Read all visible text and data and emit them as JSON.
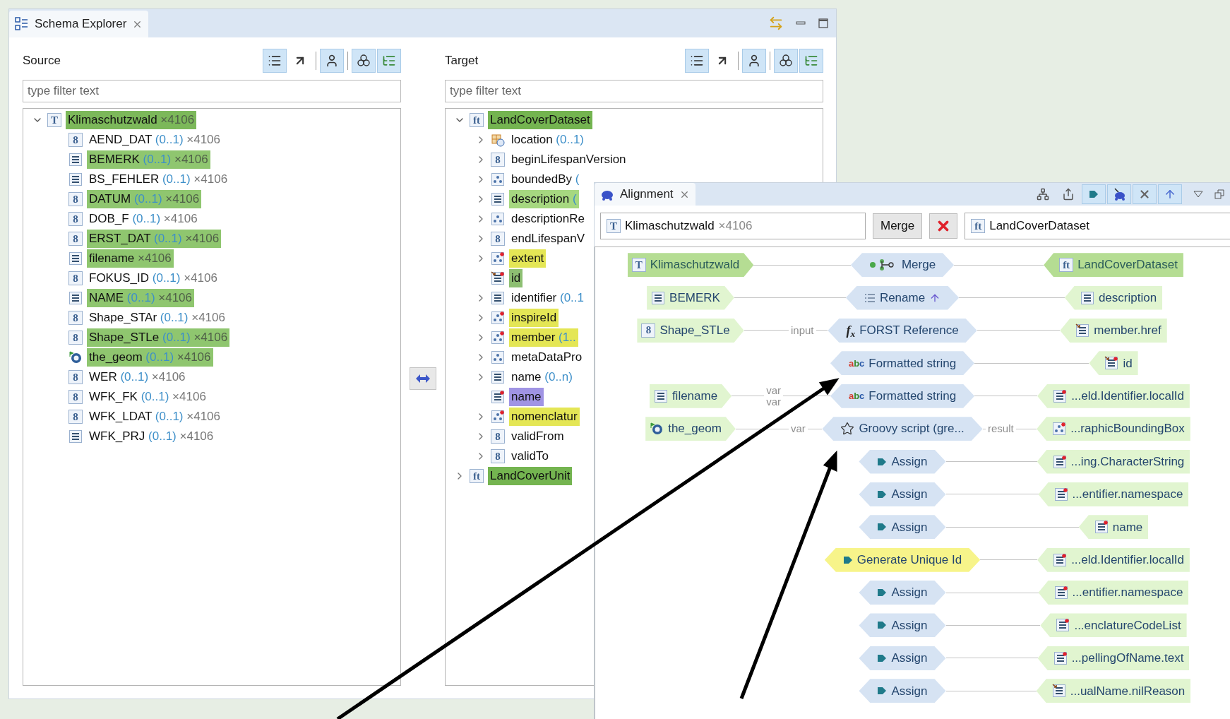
{
  "explorer": {
    "tab": {
      "title": "Schema Explorer"
    },
    "panels": [
      {
        "title": "Source",
        "tools": [
          {
            "kind": "list",
            "selected": true
          },
          {
            "kind": "goto",
            "selected": false
          },
          {
            "kind": "type",
            "selected": true
          },
          {
            "kind": "group",
            "selected": true
          },
          {
            "kind": "tree",
            "selected": true
          }
        ],
        "filter": {
          "placeholder": "type filter text"
        },
        "tree": [
          {
            "label": "Klimaschutzwald",
            "icon": {
              "kind": "letter",
              "text": "T"
            },
            "count": "×4106",
            "color": "#7cb85a",
            "expanded": true,
            "children": [
              {
                "label": "AEND_DAT",
                "cardinality": "(0..1)",
                "count": "×4106",
                "icon": {
                  "kind": "letter",
                  "text": "8"
                }
              },
              {
                "label": "BEMERK",
                "cardinality": "(0..1)",
                "count": "×4106",
                "icon": {
                  "kind": "string"
                },
                "color": "#8fc66f"
              },
              {
                "label": "BS_FEHLER",
                "cardinality": "(0..1)",
                "count": "×4106",
                "icon": {
                  "kind": "string"
                }
              },
              {
                "label": "DATUM",
                "cardinality": "(0..1)",
                "count": "×4106",
                "icon": {
                  "kind": "letter",
                  "text": "8"
                },
                "color": "#8fc66f"
              },
              {
                "label": "DOB_F",
                "cardinality": "(0..1)",
                "count": "×4106",
                "icon": {
                  "kind": "letter",
                  "text": "8"
                }
              },
              {
                "label": "ERST_DAT",
                "cardinality": "(0..1)",
                "count": "×4106",
                "icon": {
                  "kind": "letter",
                  "text": "8"
                },
                "color": "#8fc66f"
              },
              {
                "label": "filename",
                "count": "×4106",
                "icon": {
                  "kind": "string"
                },
                "color": "#8fc66f"
              },
              {
                "label": "FOKUS_ID",
                "cardinality": "(0..1)",
                "count": "×4106",
                "icon": {
                  "kind": "letter",
                  "text": "8"
                }
              },
              {
                "label": "NAME",
                "cardinality": "(0..1)",
                "count": "×4106",
                "icon": {
                  "kind": "string"
                },
                "color": "#8fc66f"
              },
              {
                "label": "Shape_STAr",
                "cardinality": "(0..1)",
                "count": "×4106",
                "icon": {
                  "kind": "letter",
                  "text": "8"
                }
              },
              {
                "label": "Shape_STLe",
                "cardinality": "(0..1)",
                "count": "×4106",
                "icon": {
                  "kind": "letter",
                  "text": "8"
                },
                "color": "#8fc66f"
              },
              {
                "label": "the_geom",
                "cardinality": "(0..1)",
                "count": "×4106",
                "icon": {
                  "kind": "geometry"
                },
                "color": "#8fc66f"
              },
              {
                "label": "WER",
                "cardinality": "(0..1)",
                "count": "×4106",
                "icon": {
                  "kind": "letter",
                  "text": "8"
                }
              },
              {
                "label": "WFK_FK",
                "cardinality": "(0..1)",
                "count": "×4106",
                "icon": {
                  "kind": "letter",
                  "text": "8"
                }
              },
              {
                "label": "WFK_LDAT",
                "cardinality": "(0..1)",
                "count": "×4106",
                "icon": {
                  "kind": "letter",
                  "text": "8"
                }
              },
              {
                "label": "WFK_PRJ",
                "cardinality": "(0..1)",
                "count": "×4106",
                "icon": {
                  "kind": "string"
                }
              }
            ]
          }
        ]
      },
      {
        "title": "Target",
        "tools": [
          {
            "kind": "list",
            "selected": true
          },
          {
            "kind": "goto",
            "selected": false
          },
          {
            "kind": "type",
            "selected": true
          },
          {
            "kind": "group",
            "selected": true
          },
          {
            "kind": "tree",
            "selected": true
          }
        ],
        "filter": {
          "placeholder": "type filter text"
        },
        "tree": [
          {
            "label": "LandCoverDataset",
            "icon": {
              "kind": "letter",
              "text": "ft"
            },
            "color": "#74b450",
            "expanded": true,
            "children": [
              {
                "label": "location",
                "cardinality": "(0..1)",
                "icon": {
                  "kind": "location"
                },
                "expanded": false
              },
              {
                "label": "beginLifespanVersion",
                "icon": {
                  "kind": "letter",
                  "text": "8"
                },
                "expanded": false
              },
              {
                "label": "boundedBy",
                "cardinality": "(",
                "icon": {
                  "kind": "group"
                },
                "expanded": false
              },
              {
                "label": "description",
                "cardinality": "(",
                "icon": {
                  "kind": "string"
                },
                "color": "#a6d880",
                "expanded": false
              },
              {
                "label": "descriptionRe",
                "icon": {
                  "kind": "group"
                },
                "expanded": false
              },
              {
                "label": "endLifespanV",
                "icon": {
                  "kind": "letter",
                  "text": "8"
                },
                "expanded": false
              },
              {
                "label": "extent",
                "icon": {
                  "kind": "group-required"
                },
                "color": "#e4e655",
                "expanded": false
              },
              {
                "label": "id",
                "icon": {
                  "kind": "reference-required"
                },
                "color": "#8dbf72"
              },
              {
                "label": "identifier",
                "cardinality": "(0..1",
                "icon": {
                  "kind": "string"
                },
                "expanded": false
              },
              {
                "label": "inspireId",
                "icon": {
                  "kind": "group-required"
                },
                "color": "#e4e655",
                "expanded": false
              },
              {
                "label": "member",
                "cardinality": "(1..",
                "icon": {
                  "kind": "group-required"
                },
                "color": "#e4e655",
                "expanded": false
              },
              {
                "label": "metaDataPro",
                "icon": {
                  "kind": "group"
                },
                "expanded": false
              },
              {
                "label": "name",
                "cardinality": "(0..n)",
                "icon": {
                  "kind": "string"
                },
                "expanded": false
              },
              {
                "label": "name",
                "icon": {
                  "kind": "string-required"
                },
                "color": "#a094e4"
              },
              {
                "label": "nomenclatur",
                "icon": {
                  "kind": "group-required"
                },
                "color": "#e4e655",
                "expanded": false
              },
              {
                "label": "validFrom",
                "icon": {
                  "kind": "letter",
                  "text": "8"
                },
                "expanded": false
              },
              {
                "label": "validTo",
                "icon": {
                  "kind": "letter",
                  "text": "8"
                },
                "expanded": false
              }
            ]
          },
          {
            "label": "LandCoverUnit",
            "icon": {
              "kind": "letter",
              "text": "ft"
            },
            "color": "#74b450",
            "expanded": false
          }
        ]
      }
    ]
  },
  "alignment": {
    "tab": {
      "title": "Alignment"
    },
    "tools": [
      {
        "kind": "hierarchy",
        "selected": false
      },
      {
        "kind": "export",
        "selected": false
      },
      {
        "kind": "play",
        "selected": true
      },
      {
        "kind": "figure",
        "selected": true
      },
      {
        "kind": "cross",
        "selected": true
      },
      {
        "kind": "up",
        "selected": true
      }
    ],
    "source_field": {
      "icon": {
        "kind": "letter",
        "text": "T"
      },
      "value": "Klimaschutzwald",
      "count": "×4106"
    },
    "merge_button": "Merge",
    "target_field": {
      "icon": {
        "kind": "letter",
        "text": "ft"
      },
      "value": "LandCoverDataset"
    },
    "cells": [
      {
        "source": {
          "label": "Klimaschutzwald",
          "icon": {
            "kind": "letter",
            "text": "T"
          },
          "kind": "type"
        },
        "function": {
          "label": "Merge",
          "icon": {
            "kind": "merge"
          },
          "highlighted": false
        },
        "target": {
          "label": "LandCoverDataset",
          "icon": {
            "kind": "letter",
            "text": "ft"
          },
          "kind": "type"
        }
      },
      {
        "source": {
          "label": "BEMERK",
          "icon": {
            "kind": "string"
          },
          "kind": "property"
        },
        "function": {
          "label": "Rename",
          "icon": {
            "kind": "rename"
          },
          "up_arrow": true,
          "highlighted": false
        },
        "target": {
          "label": "description",
          "icon": {
            "kind": "string"
          },
          "kind": "property"
        }
      },
      {
        "source": {
          "label": "Shape_STLe",
          "icon": {
            "kind": "letter",
            "text": "8"
          },
          "kind": "property"
        },
        "source_links": [
          "input"
        ],
        "function": {
          "label": "FORST Reference",
          "icon": {
            "kind": "text",
            "text": "f$_{x}$"
          },
          "highlighted": false
        },
        "target": {
          "label": "member.href",
          "icon": {
            "kind": "reference"
          },
          "kind": "property"
        }
      },
      {
        "function": {
          "label": "Formatted string",
          "icon": {
            "kind": "abc",
            "text": "abc"
          },
          "highlighted": false
        },
        "target": {
          "label": "id",
          "icon": {
            "kind": "reference-required"
          },
          "kind": "property"
        }
      },
      {
        "source": {
          "label": "filename",
          "icon": {
            "kind": "string"
          },
          "kind": "property"
        },
        "source_links": [
          "var",
          "var"
        ],
        "function": {
          "label": "Formatted string",
          "icon": {
            "kind": "abc",
            "text": "abc"
          },
          "highlighted": false
        },
        "target": {
          "label": "...eld.Identifier.localId",
          "icon": {
            "kind": "string-required"
          },
          "kind": "property"
        }
      },
      {
        "source": {
          "label": "the_geom",
          "icon": {
            "kind": "geometry"
          },
          "kind": "property"
        },
        "source_links": [
          "var"
        ],
        "function": {
          "label": "Groovy script (gre...",
          "icon": {
            "kind": "star"
          },
          "highlighted": false
        },
        "target_links": [
          "result"
        ],
        "target": {
          "label": "...raphicBoundingBox",
          "icon": {
            "kind": "group-required"
          },
          "kind": "property"
        }
      },
      {
        "function": {
          "label": "Assign",
          "icon": {
            "kind": "assign"
          },
          "highlighted": false
        },
        "target": {
          "label": "...ing.CharacterString",
          "icon": {
            "kind": "string-required"
          },
          "kind": "property"
        }
      },
      {
        "function": {
          "label": "Assign",
          "icon": {
            "kind": "assign"
          },
          "highlighted": false
        },
        "target": {
          "label": "...entifier.namespace",
          "icon": {
            "kind": "string-required"
          },
          "kind": "property"
        }
      },
      {
        "function": {
          "label": "Assign",
          "icon": {
            "kind": "assign"
          },
          "highlighted": false
        },
        "target": {
          "label": "name",
          "icon": {
            "kind": "string-required"
          },
          "kind": "property"
        }
      },
      {
        "function": {
          "label": "Generate Unique Id",
          "icon": {
            "kind": "assign"
          },
          "highlighted": true
        },
        "target": {
          "label": "...eld.Identifier.localId",
          "icon": {
            "kind": "string-required"
          },
          "kind": "property"
        }
      },
      {
        "function": {
          "label": "Assign",
          "icon": {
            "kind": "assign"
          },
          "highlighted": false
        },
        "target": {
          "label": "...entifier.namespace",
          "icon": {
            "kind": "string-required"
          },
          "kind": "property"
        }
      },
      {
        "function": {
          "label": "Assign",
          "icon": {
            "kind": "assign"
          },
          "highlighted": false
        },
        "target": {
          "label": "...enclatureCodeList",
          "icon": {
            "kind": "string-required"
          },
          "kind": "property"
        }
      },
      {
        "function": {
          "label": "Assign",
          "icon": {
            "kind": "assign"
          },
          "highlighted": false
        },
        "target": {
          "label": "...pellingOfName.text",
          "icon": {
            "kind": "string-required"
          },
          "kind": "property"
        }
      },
      {
        "function": {
          "label": "Assign",
          "icon": {
            "kind": "assign"
          },
          "highlighted": false
        },
        "target": {
          "label": "...ualName.nilReason",
          "icon": {
            "kind": "reference"
          },
          "kind": "property"
        }
      }
    ]
  }
}
